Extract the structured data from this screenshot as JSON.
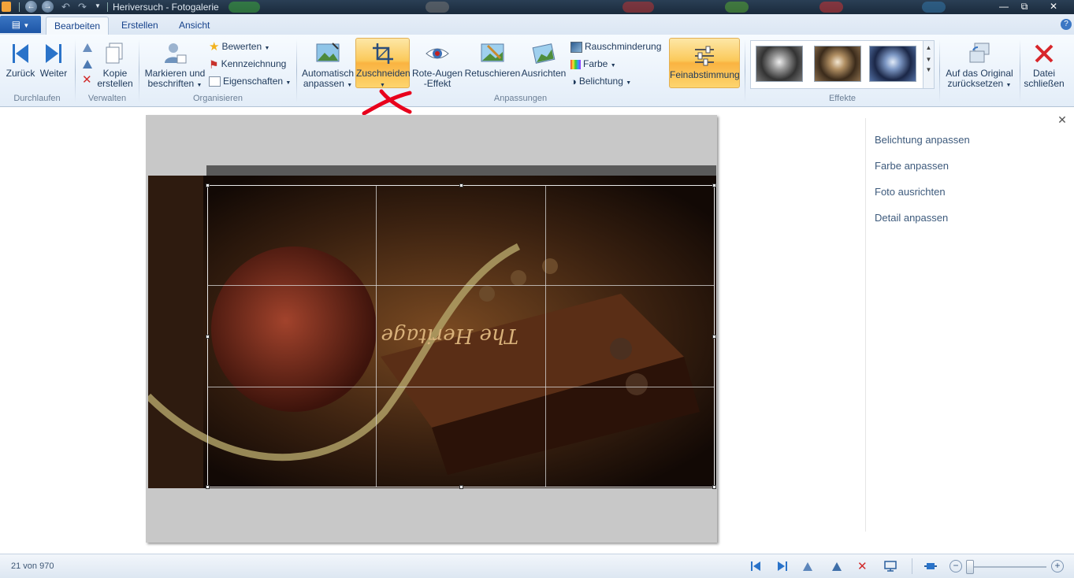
{
  "window": {
    "title": "Heriversuch - Fotogalerie",
    "controls": [
      "minimize",
      "restore",
      "close"
    ]
  },
  "tabs": [
    {
      "label": "Bearbeiten",
      "active": true
    },
    {
      "label": "Erstellen",
      "active": false
    },
    {
      "label": "Ansicht",
      "active": false
    }
  ],
  "ribbon": {
    "durchlaufen": {
      "group": "Durchlaufen",
      "back": "Zurück",
      "next": "Weiter"
    },
    "verwalten": {
      "group": "Verwalten",
      "copy_line1": "Kopie",
      "copy_line2": "erstellen"
    },
    "organisieren": {
      "group": "Organisieren",
      "tag_line1": "Markieren und",
      "tag_line2": "beschriften",
      "rate": "Bewerten",
      "flag": "Kennzeichnung",
      "properties": "Eigenschaften"
    },
    "anpassungen": {
      "group": "Anpassungen",
      "auto_line1": "Automatisch",
      "auto_line2": "anpassen",
      "crop": "Zuschneiden",
      "redeye_line1": "Rote-Augen",
      "redeye_line2": "-Effekt",
      "retouch": "Retuschieren",
      "straighten": "Ausrichten",
      "noise": "Rauschminderung",
      "color": "Farbe",
      "exposure": "Belichtung",
      "finetune": "Feinabstimmung"
    },
    "effekte": {
      "group": "Effekte"
    },
    "revert_line1": "Auf das Original",
    "revert_line2": "zurücksetzen",
    "close_line1": "Datei",
    "close_line2": "schließen"
  },
  "photo": {
    "text": "The Heritage"
  },
  "pane": {
    "links": [
      "Belichtung anpassen",
      "Farbe anpassen",
      "Foto ausrichten",
      "Detail anpassen"
    ]
  },
  "status": {
    "count": "21 von 970"
  },
  "colors": {
    "accent": "#fbc95a",
    "brand": "#1d55a6",
    "annotation": "#e8001c"
  }
}
